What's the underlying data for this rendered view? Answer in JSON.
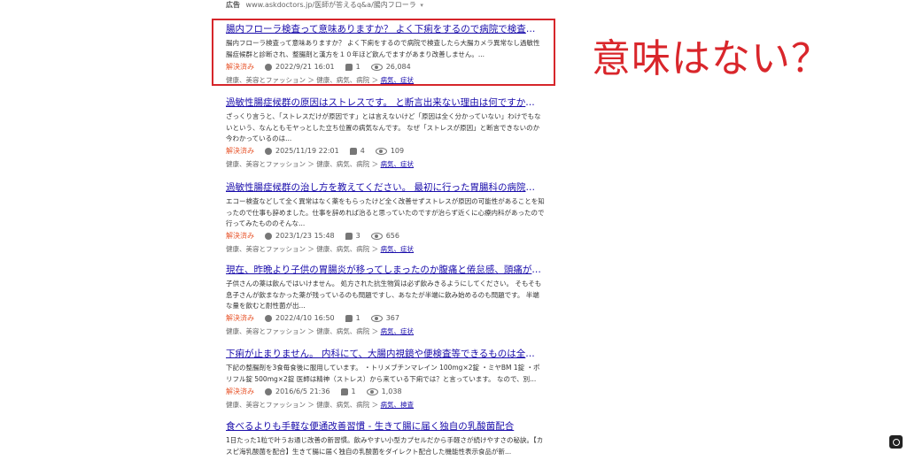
{
  "ad": {
    "label": "広告",
    "url": "www.askdoctors.jp/医師が答えるq&a/腸内フローラ"
  },
  "annotation": "意味はない？",
  "results": [
    {
      "title": "腸内フローラ検査って意味ありますか？ よく下痢をするので病院で検査したら大…",
      "snippet": "腸内フローラ検査って意味ありますか？ よく下痢をするので病院で検査したら大腸カメラ異常なし過敏性腸症候群と診断され、整腸剤と漢方を１０年ほど飲んでますがあまり改善しません。...",
      "status": "解決済み",
      "date": "2022/9/21 16:01",
      "answers": "1",
      "views": "26,084",
      "category_path": "健康、美容とファッション ＞ 健康、病気、病院 ＞ ",
      "category_link": "病気、症状"
    },
    {
      "title": "過敏性腸症候群の原因はストレスです。 と断言出来ない理由は何ですか？ 今時点…",
      "snippet": "ざっくり言うと、「ストレスだけが原因です」とは言えないけど「原因は全く分かっていない」わけでもないという、なんともモヤっとした立ち位置の病気なんです。 なぜ「ストレスが原因」と断言できないのか 今わかっているのは...",
      "status": "解決済み",
      "date": "2025/11/19 22:01",
      "answers": "4",
      "views": "109",
      "category_path": "健康、美容とファッション ＞ 健康、病気、病院 ＞ ",
      "category_link": "病気、症状"
    },
    {
      "title": "過敏性腸症候群の治し方を教えてください。 最初に行った胃腸科の病院で胃カメ…",
      "snippet": "エコー検査などして全く異常はなく薬をもらったけど全く改善せずストレスが原因の可能性があることを知ったので仕事も辞めました。仕事を辞めれば治ると思っていたのですが治らず近くに心療内科があったので行ってみたもののそんな...",
      "status": "解決済み",
      "date": "2023/1/23 15:48",
      "answers": "3",
      "views": "656",
      "category_path": "健康、美容とファッション ＞ 健康、病気、病院 ＞ ",
      "category_link": "病気、症状"
    },
    {
      "title": "現在、昨晩より子供の胃腸炎が移ってしまったのか腹痛と倦怠感、頭痛があり寝…",
      "snippet": "子供さんの薬は飲んではいけません。 処方された抗生物質は必ず飲みきるようにしてください。 そもそも息子さんが飲まなかった薬が残っているのも問題ですし、あなたが半端に飲み始めるのも問題です。 半端な量を飲むと耐性菌が出...",
      "status": "解決済み",
      "date": "2022/4/10 16:50",
      "answers": "1",
      "views": "367",
      "category_path": "健康、美容とファッション ＞ 健康、病気、病院 ＞ ",
      "category_link": "病気、症状"
    },
    {
      "title": "下痢が止まりません。 内科にて、大腸内視鏡や便検査等できるものは全部検査し…",
      "snippet": "下記の整腸剤を3食毎食後に服用しています。 ・トリメブチンマレイン 100mg×2錠 ・ミヤBM 1錠 ・ポリフル錠 500mg×2錠 医師は精神（ストレス）から来ている下痢では？と言っています。 なので、別...",
      "status": "解決済み",
      "date": "2016/6/5 21:36",
      "answers": "1",
      "views": "1,038",
      "category_path": "健康、美容とファッション ＞ 健康、病気、病院 ＞ ",
      "category_link": "病気、検査"
    },
    {
      "title": "食べるよりも手軽な便通改善習慣 - 生きて腸に届く独自の乳酸菌配合",
      "snippet": "1日たった1粒で叶うお通じ改善の新習慣。飲みやすい小型カプセルだから手軽さが続けやすさの秘訣。【カスピ海乳酸菌を配合】生きて腸に届く独自の乳酸菌をダイレクト配合した機能性表示食品が新..."
    }
  ]
}
